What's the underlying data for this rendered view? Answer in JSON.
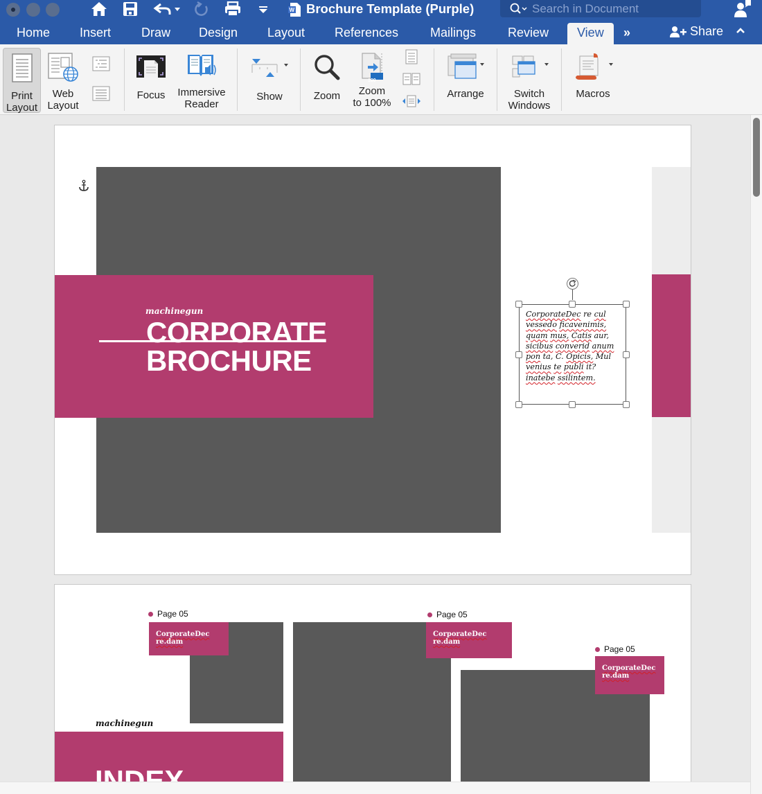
{
  "window": {
    "title": "Brochure Template (Purple)",
    "traffic_lights": [
      "close",
      "minimize",
      "zoom"
    ]
  },
  "quick_access": [
    {
      "name": "home-icon"
    },
    {
      "name": "save-icon"
    },
    {
      "name": "undo-icon"
    },
    {
      "name": "redo-icon"
    },
    {
      "name": "print-icon"
    },
    {
      "name": "customize-toolbar-icon"
    }
  ],
  "search": {
    "placeholder": "Search in Document"
  },
  "tabs": [
    {
      "label": "Home"
    },
    {
      "label": "Insert"
    },
    {
      "label": "Draw"
    },
    {
      "label": "Design"
    },
    {
      "label": "Layout"
    },
    {
      "label": "References"
    },
    {
      "label": "Mailings"
    },
    {
      "label": "Review"
    },
    {
      "label": "View",
      "active": true
    }
  ],
  "overflow_label": "»",
  "share_label": "Share",
  "ribbon": {
    "print_layout": {
      "line1": "Print",
      "line2": "Layout"
    },
    "web_layout": {
      "line1": "Web",
      "line2": "Layout"
    },
    "focus": {
      "line1": "Focus"
    },
    "immersive_reader": {
      "line1": "Immersive",
      "line2": "Reader"
    },
    "show": {
      "line1": "Show"
    },
    "zoom": {
      "line1": "Zoom"
    },
    "zoom100": {
      "line1": "Zoom",
      "line2": "to 100%"
    },
    "arrange": {
      "line1": "Arrange"
    },
    "switch_windows": {
      "line1": "Switch",
      "line2": "Windows"
    },
    "macros": {
      "line1": "Macros"
    },
    "zoom100_badge": "100"
  },
  "document": {
    "page1": {
      "brand": "machinegun",
      "title_line1": "CORPORATE",
      "title_line2": "BROCHURE",
      "textbox_words": [
        {
          "t": "CorporateDec",
          "err": true
        },
        {
          "t": " re ",
          "err": false
        },
        {
          "t": "cul",
          "err": true
        },
        {
          "t": " ",
          "err": false
        },
        {
          "t": "vessedo",
          "err": true
        },
        {
          "t": " ",
          "err": false
        },
        {
          "t": "ficavenimis,",
          "err": true
        },
        {
          "t": " ",
          "err": false
        },
        {
          "t": "quam",
          "err": true
        },
        {
          "t": " ",
          "err": false
        },
        {
          "t": "mus,",
          "err": true
        },
        {
          "t": " ",
          "err": false
        },
        {
          "t": "Catis",
          "err": true
        },
        {
          "t": " aur, ",
          "err": false
        },
        {
          "t": "sicibus",
          "err": true
        },
        {
          "t": " ",
          "err": false
        },
        {
          "t": "converid",
          "err": true
        },
        {
          "t": " ",
          "err": false
        },
        {
          "t": "anum",
          "err": true
        },
        {
          "t": " ",
          "err": false
        },
        {
          "t": "pon",
          "err": true
        },
        {
          "t": " ta, C. ",
          "err": false
        },
        {
          "t": "Opicis,",
          "err": true
        },
        {
          "t": " Mul ",
          "err": false
        },
        {
          "t": "venius",
          "err": true
        },
        {
          "t": " ",
          "err": false
        },
        {
          "t": "te",
          "err": true
        },
        {
          "t": " ",
          "err": false
        },
        {
          "t": "publi",
          "err": true
        },
        {
          "t": " it? ",
          "err": false
        },
        {
          "t": "inatebe",
          "err": true
        },
        {
          "t": " ",
          "err": false
        },
        {
          "t": "ssilintem.",
          "err": true
        }
      ]
    },
    "page2": {
      "brand": "machinegun",
      "heading": "INDEX",
      "items": [
        {
          "page_label": "Page 05",
          "caption_line1": "CorporateDec",
          "caption_line2": "re.dam"
        },
        {
          "page_label": "Page 05",
          "caption_line1": "CorporateDec",
          "caption_line2": "re.dam"
        },
        {
          "page_label": "Page 05",
          "caption_line1": "CorporateDec",
          "caption_line2": "re.dam"
        }
      ]
    }
  },
  "colors": {
    "brand_blue": "#2b5aa8",
    "accent_pink": "#b23c6e",
    "placeholder_grey": "#595959",
    "spell_error": "#d21f26"
  }
}
